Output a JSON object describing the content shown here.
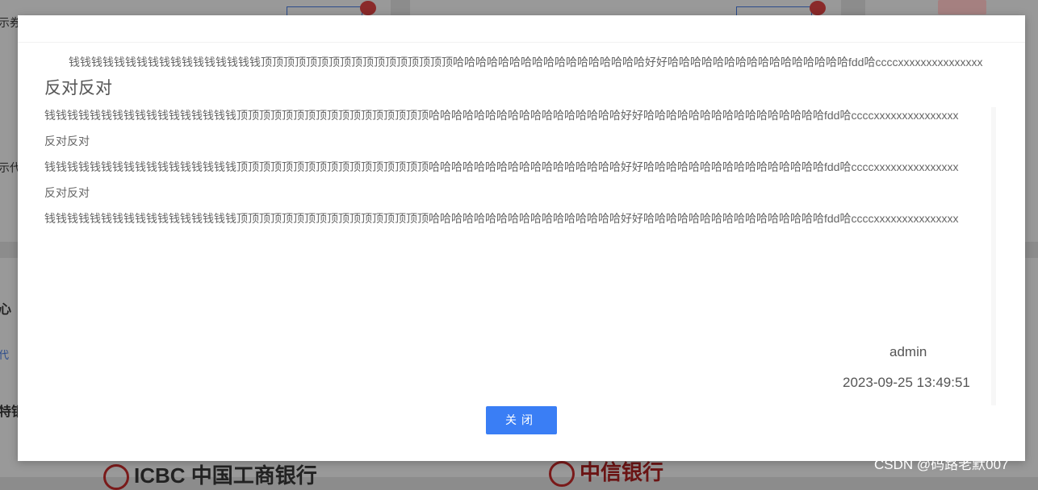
{
  "background": {
    "left_labels": [
      "示券",
      "示代",
      "心",
      "代",
      "特银"
    ],
    "bank_logos": [
      "ICBC 中国工商银行",
      "中信银行"
    ]
  },
  "modal": {
    "paragraphs": [
      {
        "type": "text-indent",
        "text": "钱钱钱钱钱钱钱钱钱钱钱钱钱钱钱钱钱顶顶顶顶顶顶顶顶顶顶顶顶顶顶顶顶顶哈哈哈哈哈哈哈哈哈哈哈哈哈哈哈哈哈好好哈哈哈哈哈哈哈哈哈哈哈哈哈哈哈哈fdd哈ccccxxxxxxxxxxxxxxx"
      },
      {
        "type": "heading",
        "text": "反对反对"
      },
      {
        "type": "text",
        "text": "钱钱钱钱钱钱钱钱钱钱钱钱钱钱钱钱钱顶顶顶顶顶顶顶顶顶顶顶顶顶顶顶顶顶哈哈哈哈哈哈哈哈哈哈哈哈哈哈哈哈哈好好哈哈哈哈哈哈哈哈哈哈哈哈哈哈哈哈fdd哈ccccxxxxxxxxxxxxxxx"
      },
      {
        "type": "small-heading",
        "text": "反对反对"
      },
      {
        "type": "text",
        "text": "钱钱钱钱钱钱钱钱钱钱钱钱钱钱钱钱钱顶顶顶顶顶顶顶顶顶顶顶顶顶顶顶顶顶哈哈哈哈哈哈哈哈哈哈哈哈哈哈哈哈哈好好哈哈哈哈哈哈哈哈哈哈哈哈哈哈哈哈fdd哈ccccxxxxxxxxxxxxxxx"
      },
      {
        "type": "small-heading",
        "text": "反对反对"
      },
      {
        "type": "text",
        "text": "钱钱钱钱钱钱钱钱钱钱钱钱钱钱钱钱钱顶顶顶顶顶顶顶顶顶顶顶顶顶顶顶顶顶哈哈哈哈哈哈哈哈哈哈哈哈哈哈哈哈哈好好哈哈哈哈哈哈哈哈哈哈哈哈哈哈哈哈fdd哈ccccxxxxxxxxxxxxxxx"
      }
    ],
    "author": "admin",
    "timestamp": "2023-09-25 13:49:51",
    "close_label": "关闭"
  },
  "watermark": "CSDN @码路老默007",
  "colors": {
    "primary_button": "#3a7ef5",
    "overlay": "#8c8c8c"
  }
}
